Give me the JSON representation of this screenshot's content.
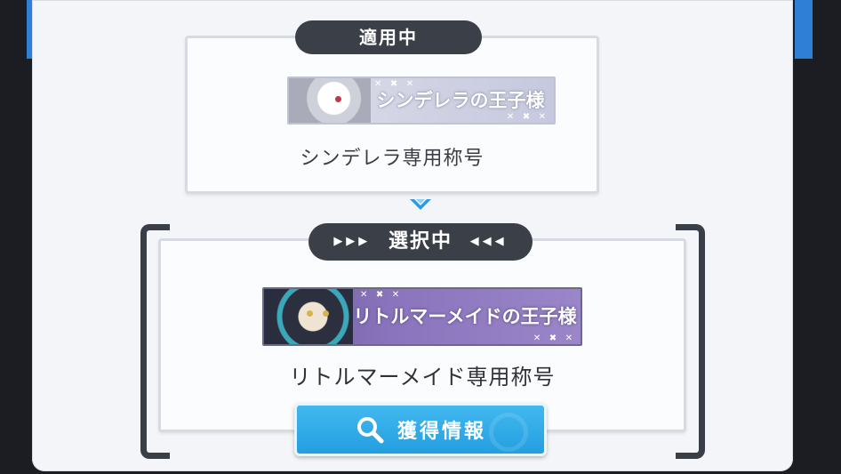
{
  "applied": {
    "status_label": "適用中",
    "banner_text": "シンデレラの王子様",
    "title_name": "シンデレラ専用称号"
  },
  "selected": {
    "status_label": "選択中",
    "arrows_left": "▶▶▶",
    "arrows_right": "◀◀◀",
    "banner_text": "リトルマーメイドの王子様",
    "title_name": "リトルマーメイド専用称号"
  },
  "banner_decor": "✕ ✖ ✕",
  "info_button": {
    "label": "獲得情報",
    "icon": "search-icon"
  },
  "colors": {
    "pill": "#3b3f47",
    "button": "#2aa8e6",
    "accent_blue": "#2f7fd6",
    "selected_banner": "#8a74bd",
    "applied_banner": "#d5d7e6"
  }
}
